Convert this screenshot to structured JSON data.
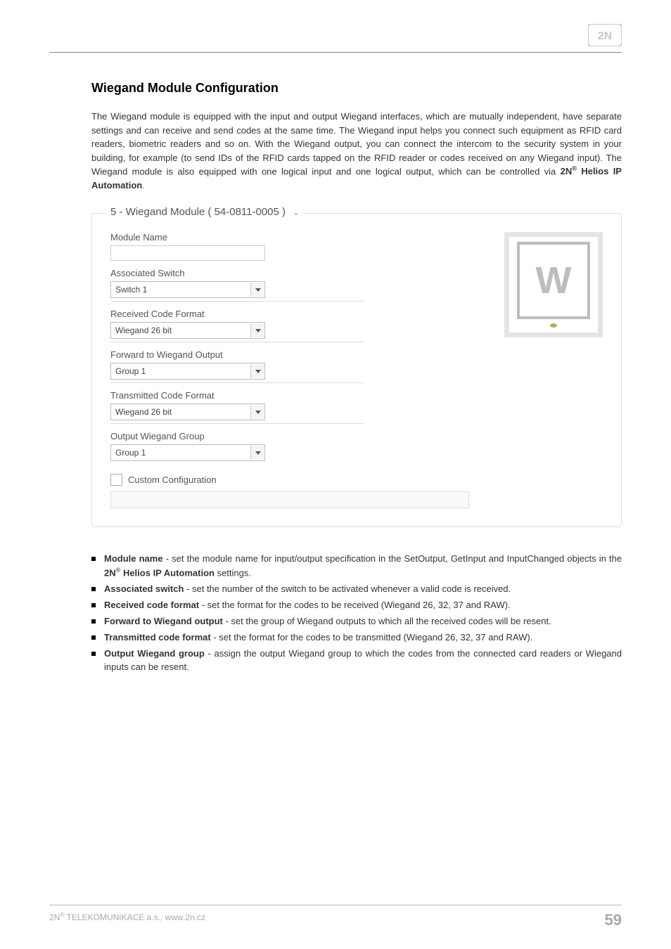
{
  "logo": {
    "alt": "2N"
  },
  "heading": "Wiegand Module Configuration",
  "intro_parts": {
    "p1": "The Wiegand module is equipped with the input and output Wiegand interfaces, which are mutually independent, have separate settings and can receive and send codes at the same time. The Wiegand input helps you connect such equipment as RFID card readers, biometric readers and so on. With the Wiegand output, you can connect the intercom to the security system in your building, for example (to send IDs of the RFID cards tapped on the RFID reader or codes received on any Wiegand input). The Wiegand module is also equipped with one logical input and one logical output, which can be controlled via ",
    "p_bold1": "2N",
    "p_bold2": " Helios IP Automation",
    "p_end": "."
  },
  "panel": {
    "title": "5 - Wiegand Module ( 54-0811-0005 )",
    "module_name_label": "Module Name",
    "module_name_value": "",
    "assoc_switch_label": "Associated Switch",
    "assoc_switch_value": "Switch 1",
    "recv_format_label": "Received Code Format",
    "recv_format_value": "Wiegand 26 bit",
    "fwd_output_label": "Forward to Wiegand Output",
    "fwd_output_value": "Group 1",
    "trans_format_label": "Transmitted Code Format",
    "trans_format_value": "Wiegand 26 bit",
    "out_group_label": "Output Wiegand Group",
    "out_group_value": "Group 1",
    "custom_config_label": "Custom Configuration",
    "module_letter": "W"
  },
  "bullets": [
    {
      "term": "Module name",
      "text_before": " - set the module name for input/output specification in the SetOutput, GetInput and InputChanged objects in the ",
      "brand_bold": "2N",
      "brand_suffix": " Helios IP Automation",
      "text_after": " settings."
    },
    {
      "term": "Associated switch",
      "text_before": " - set the number of the switch to be activated whenever a valid code is received",
      "brand_bold": "",
      "brand_suffix": "",
      "text_after": "."
    },
    {
      "term": "Received code format",
      "text_before": " - set the format for the codes to be received (Wiegand 26, 32, 37 and RAW).",
      "brand_bold": "",
      "brand_suffix": "",
      "text_after": ""
    },
    {
      "term": "Forward to Wiegand output",
      "text_before": " - set the group of Wiegand outputs to which all the received codes will be resent",
      "brand_bold": "",
      "brand_suffix": "",
      "text_after": "."
    },
    {
      "term": "Transmitted code format",
      "text_before": " - set the format for the codes to be transmitted (Wiegand 26, 32, 37 and RAW).",
      "brand_bold": "",
      "brand_suffix": "",
      "text_after": ""
    },
    {
      "term": "Output Wiegand group",
      "text_before": " - assign the output Wiegand group to which the codes from the connected card readers or Wiegand inputs can be resent.",
      "brand_bold": "",
      "brand_suffix": "",
      "text_after": ""
    }
  ],
  "footer": {
    "left_before": "2N",
    "left_after": " TELEKOMUNIKACE a.s., www.2n.cz",
    "page": "59"
  }
}
